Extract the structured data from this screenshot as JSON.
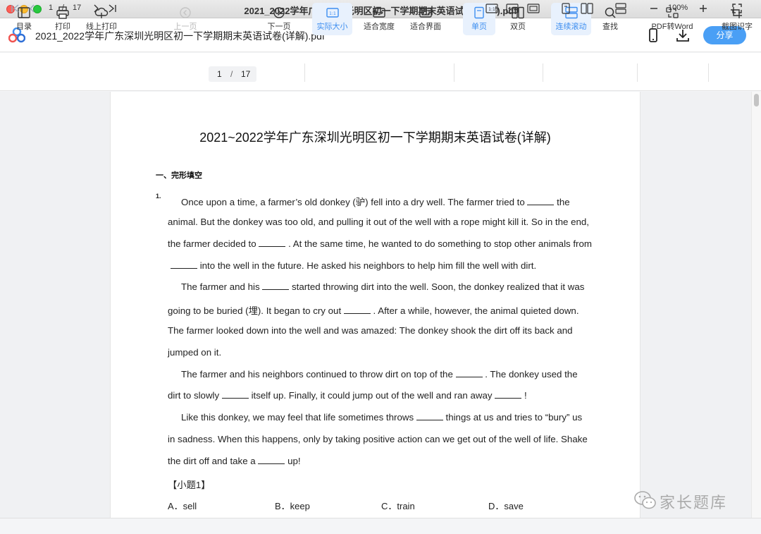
{
  "window": {
    "title": "2021_2022学年广东深圳光明区初一下学期期末英语试卷 (详解).pdf"
  },
  "header": {
    "file_name": "2021_2022学年广东深圳光明区初一下学期期末英语试卷(详解).pdf",
    "share_label": "分享"
  },
  "toolbar": {
    "toc": "目录",
    "print": "打印",
    "online_print": "线上打印",
    "prev_page": "上一页",
    "current_page": "1",
    "page_sep": "/",
    "total_pages": "17",
    "next_page": "下一页",
    "actual_size": "实际大小",
    "fit_width": "适合宽度",
    "fit_page": "适合界面",
    "single_page": "单页",
    "double_page": "双页",
    "continuous_scroll": "连续滚动",
    "find": "查找",
    "pdf_to_word": "PDF转Word",
    "ocr": "截图识字"
  },
  "document": {
    "title": "2021~2022学年广东深圳光明区初一下学期期末英语试卷(详解)",
    "section": "一、完形填空",
    "question_number": "1.",
    "lines": [
      {
        "a": "Once upon a time, a farmer’s old donkey (驴) fell into a dry well. The farmer tried to",
        "b": "the"
      },
      {
        "a": "animal. But the donkey was too old, and pulling it out of the well with a rope might kill it. So in the end,"
      },
      {
        "a": "the farmer decided to",
        "b": ". At the same time, he wanted to do something to stop other animals from"
      },
      {
        "a": "",
        "b": "into the well in the future. He asked his neighbors to help him fill the well with dirt."
      },
      {
        "a": "The farmer and his",
        "b": "started throwing dirt into the well. Soon, the donkey realized that it was"
      },
      {
        "a": "going to be buried (埋). It began to cry out",
        "b": ". After a while, however, the animal quieted down."
      },
      {
        "a": "The farmer looked down into the well and was amazed: The donkey shook the dirt off its back and"
      },
      {
        "a": "jumped on it."
      },
      {
        "a": "The farmer and his neighbors continued to throw dirt on top of the",
        "b": ". The donkey used the"
      },
      {
        "a": "dirt to slowly",
        "b": "itself up. Finally, it could jump out of the well and ran away",
        "c": "!"
      },
      {
        "a": "Like this donkey, we may feel that life sometimes throws",
        "b": "things at us and tries to “bury” us"
      },
      {
        "a": "in sadness. When this happens, only by taking positive action can we get out of the well of life. Shake"
      },
      {
        "a": "the dirt off and take a",
        "b": "up!"
      }
    ],
    "sub_question": "【小题1】",
    "options": [
      "A．sell",
      "B．keep",
      "C．train",
      "D．save"
    ]
  },
  "watermark": {
    "text": "家长题库"
  },
  "statusbar": {
    "current_page": "1",
    "sep": "/",
    "total_pages": "17",
    "zoom": "100%"
  }
}
